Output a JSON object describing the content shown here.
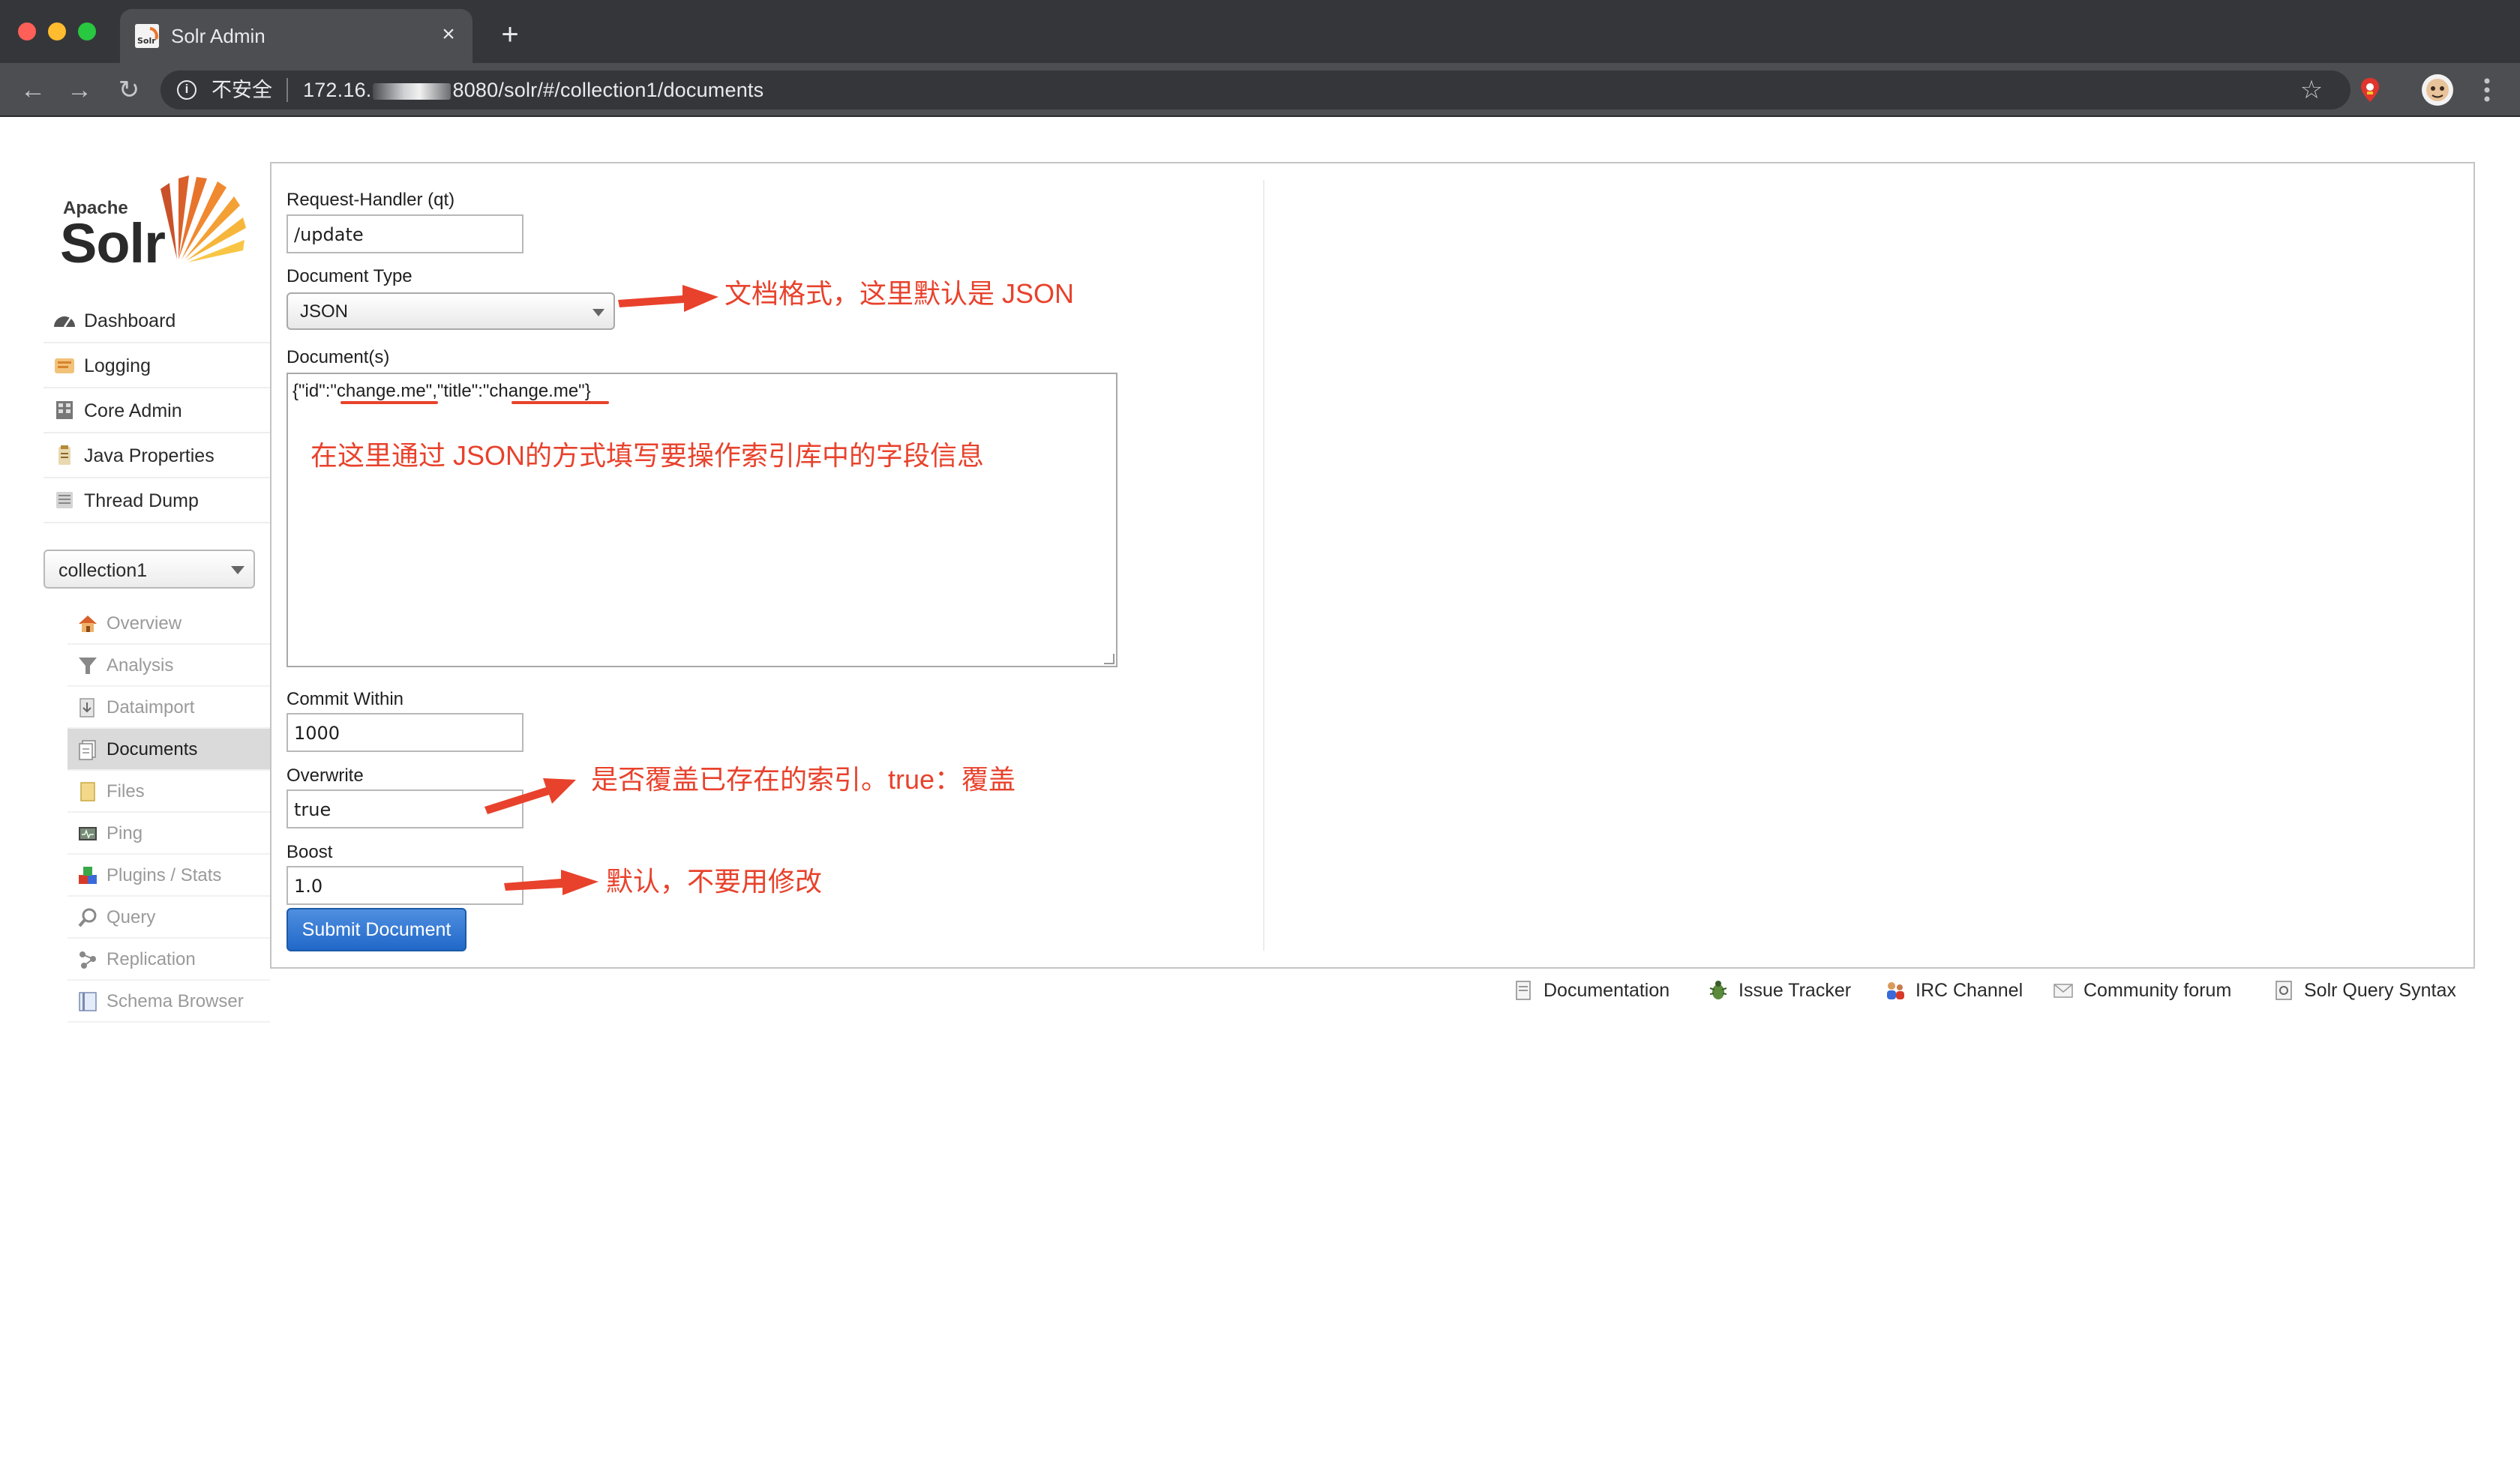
{
  "browser": {
    "tab_title": "Solr Admin",
    "tab_close": "×",
    "new_tab": "+",
    "back": "←",
    "forward": "→",
    "reload": "↻",
    "insecure_label": "不安全",
    "url_prefix": "172.16.",
    "url_suffix": "8080/solr/#/collection1/documents",
    "star": "☆",
    "info": "i"
  },
  "logo": {
    "apache": "Apache",
    "solr": "Solr"
  },
  "sidebar": {
    "items": [
      {
        "label": "Dashboard"
      },
      {
        "label": "Logging"
      },
      {
        "label": "Core Admin"
      },
      {
        "label": "Java Properties"
      },
      {
        "label": "Thread Dump"
      }
    ],
    "core_selector": {
      "value": "collection1"
    },
    "core_items": [
      {
        "label": "Overview",
        "active": false
      },
      {
        "label": "Analysis",
        "active": false
      },
      {
        "label": "Dataimport",
        "active": false
      },
      {
        "label": "Documents",
        "active": true
      },
      {
        "label": "Files",
        "active": false
      },
      {
        "label": "Ping",
        "active": false
      },
      {
        "label": "Plugins / Stats",
        "active": false
      },
      {
        "label": "Query",
        "active": false
      },
      {
        "label": "Replication",
        "active": false
      },
      {
        "label": "Schema Browser",
        "active": false
      }
    ]
  },
  "form": {
    "request_handler_label": "Request-Handler (qt)",
    "request_handler_value": "/update",
    "document_type_label": "Document Type",
    "document_type_value": "JSON",
    "documents_label": "Document(s)",
    "documents_value": "{\"id\":\"change.me\",\"title\":\"change.me\"}",
    "commit_within_label": "Commit Within",
    "commit_within_value": "1000",
    "overwrite_label": "Overwrite",
    "overwrite_value": "true",
    "boost_label": "Boost",
    "boost_value": "1.0",
    "submit_label": "Submit Document"
  },
  "footer": {
    "links": [
      {
        "label": "Documentation"
      },
      {
        "label": "Issue Tracker"
      },
      {
        "label": "IRC Channel"
      },
      {
        "label": "Community forum"
      },
      {
        "label": "Solr Query Syntax"
      }
    ]
  },
  "annotations": {
    "document_type_note": "文档格式，这里默认是 JSON",
    "documents_note": "在这里通过 JSON的方式填写要操作索引库中的字段信息",
    "overwrite_note": "是否覆盖已存在的索引。true：覆盖",
    "boost_note": "默认，不要用修改"
  },
  "colors": {
    "annotation": "#e8422c",
    "submit_button": "#2168c8",
    "active_menu": "#dadada",
    "chrome_dark": "#35363a"
  }
}
